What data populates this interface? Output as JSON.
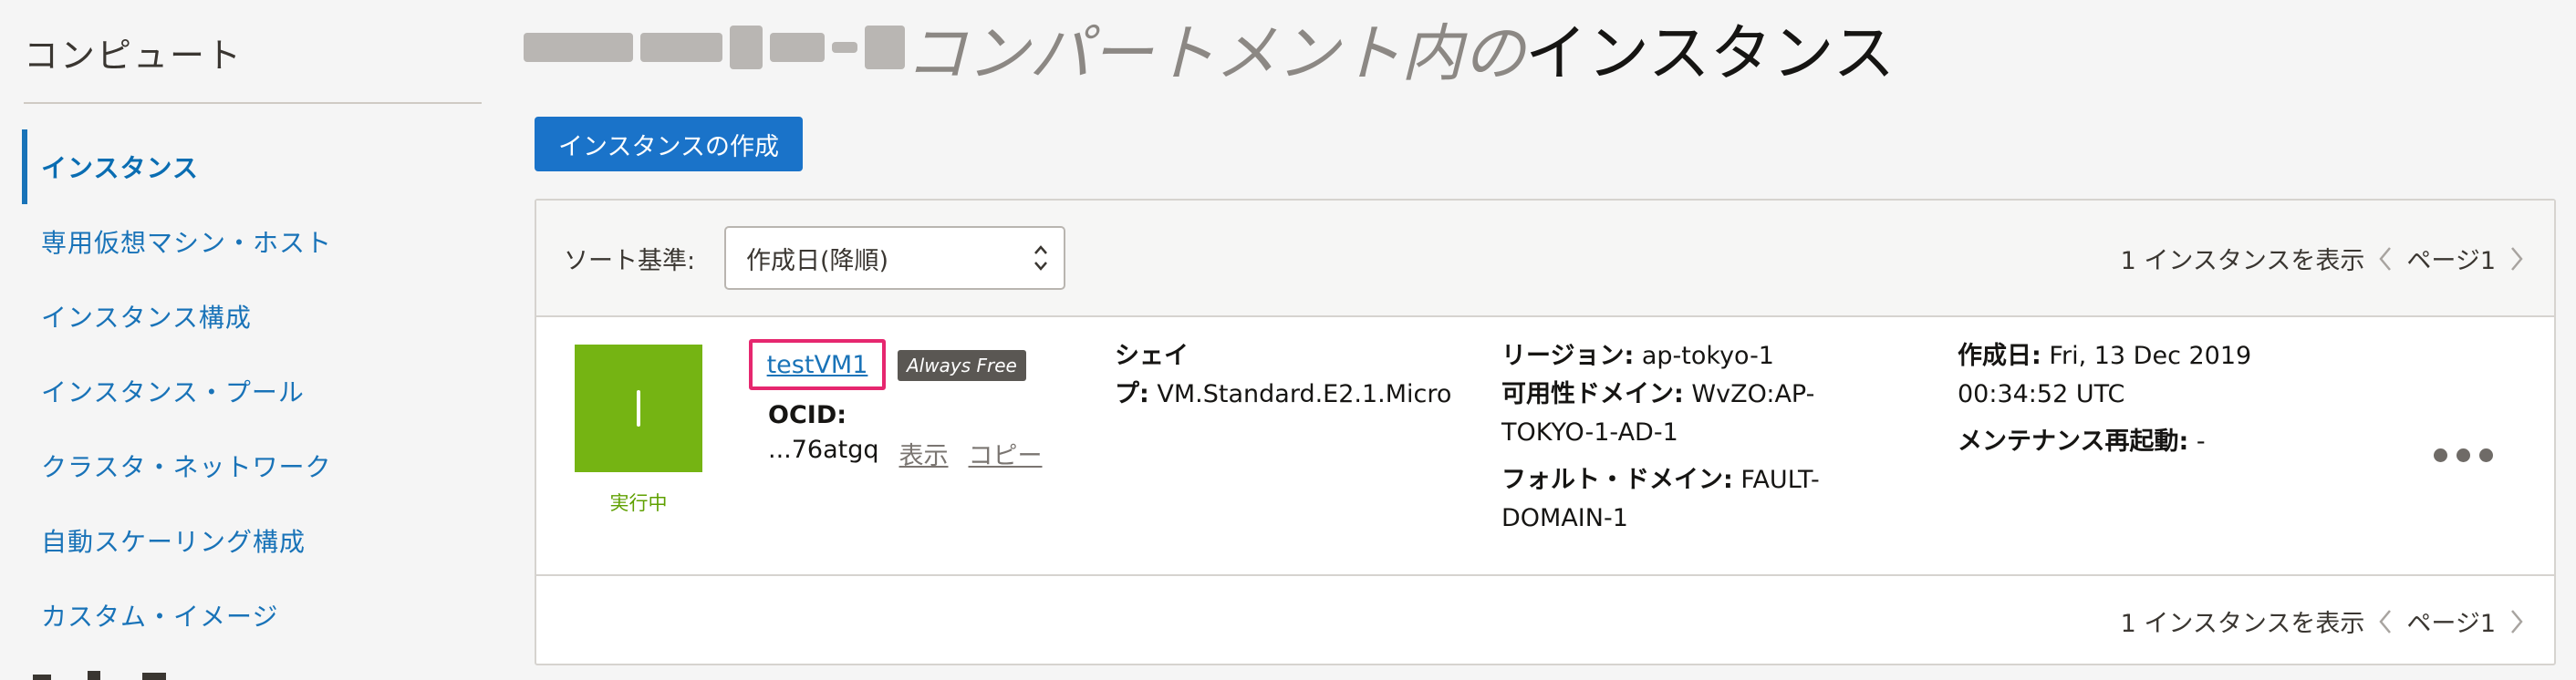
{
  "sidebar": {
    "title": "コンピュート",
    "items": [
      {
        "label": "インスタンス",
        "active": true
      },
      {
        "label": "専用仮想マシン・ホスト"
      },
      {
        "label": "インスタンス構成"
      },
      {
        "label": "インスタンス・プール"
      },
      {
        "label": "クラスタ・ネットワーク"
      },
      {
        "label": "自動スケーリング構成"
      },
      {
        "label": "カスタム・イメージ"
      }
    ]
  },
  "header": {
    "title_italic": "コンパートメント内の",
    "title_normal": "インスタンス"
  },
  "create_button": "インスタンスの作成",
  "sort": {
    "label": "ソート基準:",
    "value": "作成日(降順)"
  },
  "pager": {
    "summary": "1 インスタンスを表示",
    "page": "ページ1"
  },
  "instance": {
    "status": "実行中",
    "name": "testVM1",
    "badge": "Always Free",
    "ocid_label": "OCID:",
    "ocid_value": "...76atgq",
    "show_link": "表示",
    "copy_link": "コピー",
    "shape_label_1": "シェイ",
    "shape_label_2": "プ:",
    "shape_value": "VM.Standard.E2.1.Micro",
    "region_label": "リージョン:",
    "region_value": "ap-tokyo-1",
    "ad_label": "可用性ドメイン:",
    "ad_value_1": "WvZO:AP-",
    "ad_value_2": "TOKYO-1-AD-1",
    "fd_label": "フォルト・ドメイン:",
    "fd_value_1": "FAULT-",
    "fd_value_2": "DOMAIN-1",
    "created_label": "作成日:",
    "created_value_1": "Fri, 13 Dec 2019",
    "created_value_2": "00:34:52 UTC",
    "maint_label": "メンテナンス再起動:",
    "maint_value": "-"
  },
  "colors": {
    "accent": "#1a73c9",
    "status_green": "#75b413",
    "highlight": "#e6276f"
  }
}
